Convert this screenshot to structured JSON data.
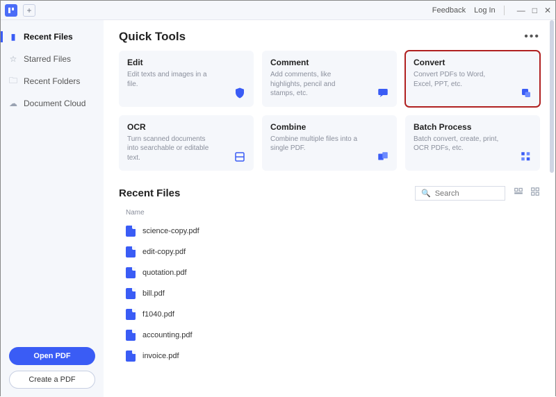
{
  "titlebar": {
    "feedback": "Feedback",
    "login": "Log In"
  },
  "sidebar": {
    "items": [
      {
        "label": "Recent Files",
        "active": true
      },
      {
        "label": "Starred Files",
        "active": false
      },
      {
        "label": "Recent Folders",
        "active": false
      },
      {
        "label": "Document Cloud",
        "active": false
      }
    ],
    "open_btn": "Open PDF",
    "create_btn": "Create a PDF"
  },
  "quick_tools": {
    "title": "Quick Tools",
    "cards": [
      {
        "title": "Edit",
        "desc": "Edit texts and images in a file."
      },
      {
        "title": "Comment",
        "desc": "Add comments, like highlights, pencil and stamps, etc."
      },
      {
        "title": "Convert",
        "desc": "Convert PDFs to Word, Excel, PPT, etc.",
        "highlight": true
      },
      {
        "title": "OCR",
        "desc": "Turn scanned documents into searchable or editable text."
      },
      {
        "title": "Combine",
        "desc": "Combine multiple files into a single PDF."
      },
      {
        "title": "Batch Process",
        "desc": "Batch convert, create, print, OCR PDFs, etc."
      }
    ]
  },
  "recent": {
    "title": "Recent Files",
    "search_placeholder": "Search",
    "col_name": "Name",
    "files": [
      "science-copy.pdf",
      "edit-copy.pdf",
      "quotation.pdf",
      "bill.pdf",
      "f1040.pdf",
      "accounting.pdf",
      "invoice.pdf"
    ]
  }
}
